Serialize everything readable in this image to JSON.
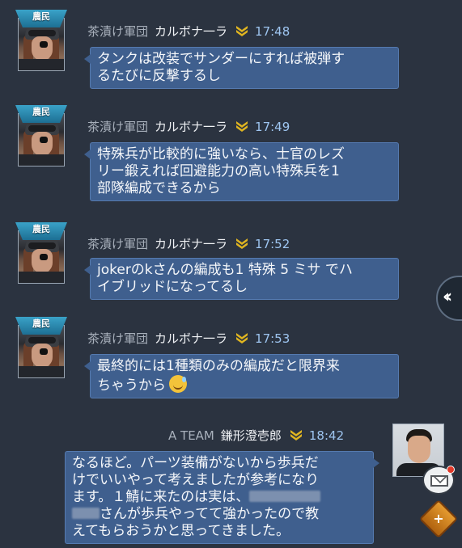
{
  "messages": [
    {
      "rank": "農民",
      "guild": "茶漬け軍団",
      "name": "カルボナ一ラ",
      "time": "17:48",
      "lines": [
        "タンクは改装でサンダーにすれば被弾す",
        "るたびに反撃するし"
      ]
    },
    {
      "rank": "農民",
      "guild": "茶漬け軍団",
      "name": "カルボナ一ラ",
      "time": "17:49",
      "lines": [
        "特殊兵が比較的に強いなら、士官のレズ",
        "リー鍛えれば回避能力の高い特殊兵を1",
        "部隊編成できるから"
      ]
    },
    {
      "rank": "農民",
      "guild": "茶漬け軍団",
      "name": "カルボナ一ラ",
      "time": "17:52",
      "lines": [
        "jokerのkさんの編成も1 特殊 5 ミサ でハ",
        "イブリッドになってるし"
      ]
    },
    {
      "rank": "農民",
      "guild": "茶漬け軍団",
      "name": "カルボナ一ラ",
      "time": "17:53",
      "lines": [
        "最終的には1種類のみの編成だと限界来",
        "ちゃうから"
      ]
    }
  ],
  "own_message": {
    "guild": "A TEAM",
    "name": "鎌形澄壱郎",
    "time": "18:42",
    "line1": "なるほど。パーツ装備がないから歩兵だ",
    "line2": "けでいいやって考えましたが参考にな",
    "line3_a": "ます。１鯖に来たのは実は、",
    "line4_b": "さんが歩兵やってて強かったので教",
    "line5": "えてもらおうかと思ってきました。",
    "line2_end": "り"
  },
  "side_tab": {
    "label": "‹‹"
  },
  "emoji": {
    "name": "sweat-smile-emoji"
  },
  "colors": {
    "bubble": "#3f5f8e",
    "time": "#9ec5f0",
    "background": "#2b3340"
  }
}
